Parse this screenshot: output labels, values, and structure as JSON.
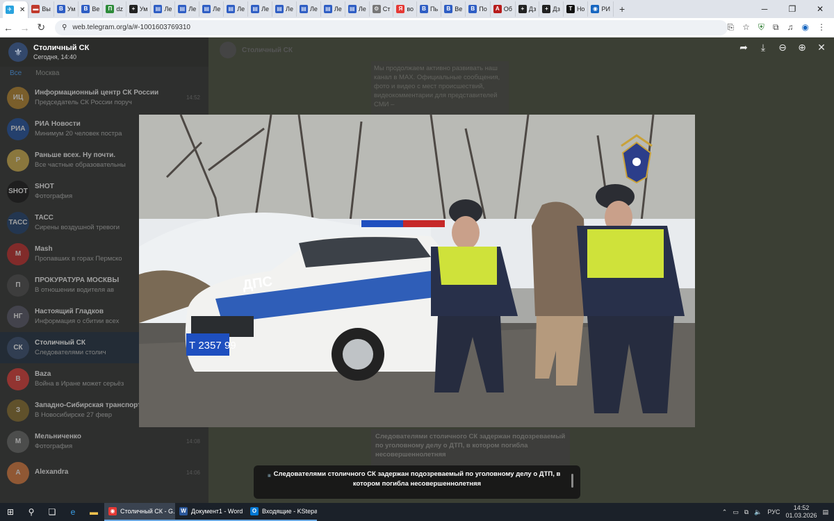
{
  "browser": {
    "tabs": [
      {
        "label": "",
        "active": true,
        "color": "#2aa3de",
        "glyph": "✈"
      },
      {
        "label": "Вы",
        "color": "#c0392b",
        "glyph": "▬"
      },
      {
        "label": "Ум",
        "color": "#2f5ec4",
        "glyph": "В"
      },
      {
        "label": "Ве",
        "color": "#2f5ec4",
        "glyph": "В"
      },
      {
        "label": "dz",
        "color": "#2e8b3a",
        "glyph": "П"
      },
      {
        "label": "Ум",
        "color": "#222",
        "glyph": "+"
      },
      {
        "label": "Ле",
        "color": "#2f5ec4",
        "glyph": "▤"
      },
      {
        "label": "Ле",
        "color": "#2f5ec4",
        "glyph": "▤"
      },
      {
        "label": "Ле",
        "color": "#2f5ec4",
        "glyph": "▤"
      },
      {
        "label": "Ле",
        "color": "#2f5ec4",
        "glyph": "▤"
      },
      {
        "label": "Ле",
        "color": "#2f5ec4",
        "glyph": "▤"
      },
      {
        "label": "Ле",
        "color": "#2f5ec4",
        "glyph": "▤"
      },
      {
        "label": "Ле",
        "color": "#2f5ec4",
        "glyph": "▤"
      },
      {
        "label": "Ле",
        "color": "#2f5ec4",
        "glyph": "▤"
      },
      {
        "label": "Ле",
        "color": "#2f5ec4",
        "glyph": "▤"
      },
      {
        "label": "Ст",
        "color": "#777",
        "glyph": "⚙"
      },
      {
        "label": "во",
        "color": "#e53935",
        "glyph": "Я"
      },
      {
        "label": "Пь",
        "color": "#2f5ec4",
        "glyph": "В"
      },
      {
        "label": "Ве",
        "color": "#2f5ec4",
        "glyph": "В"
      },
      {
        "label": "По",
        "color": "#2f5ec4",
        "glyph": "В"
      },
      {
        "label": "Об",
        "color": "#b71c1c",
        "glyph": "A"
      },
      {
        "label": "Дз",
        "color": "#222",
        "glyph": "+"
      },
      {
        "label": "Дз",
        "color": "#222",
        "glyph": "+"
      },
      {
        "label": "Но",
        "color": "#111",
        "glyph": "T"
      },
      {
        "label": "РИ",
        "color": "#1565c0",
        "glyph": "◉"
      }
    ],
    "url": "web.telegram.org/a/#-1001603769310"
  },
  "sidebar": {
    "channel_title": "Столичный СК",
    "channel_sub": "Сегодня, 14:40",
    "filter_all": "Все",
    "filter_moscow": "Москва",
    "chats": [
      {
        "name": "Информационный центр СК России",
        "preview": "Председатель СК России поруч",
        "time": "14:52",
        "color": "#b8862a",
        "initial": "ИЦ"
      },
      {
        "name": "РИА Новости",
        "preview": "Минимум 20 человек постра",
        "time": "",
        "color": "#1d4fa1",
        "initial": "РИА"
      },
      {
        "name": "Раньше всех. Ну почти.",
        "preview": "Все частные образовательны",
        "time": "",
        "color": "#d6b24a",
        "initial": "Р"
      },
      {
        "name": "SHOT",
        "preview": "Фотография",
        "time": "",
        "color": "#111",
        "initial": "SHOT"
      },
      {
        "name": "ТАСС",
        "preview": "Сирены воздушной тревоги",
        "time": "",
        "color": "#1b3d6d",
        "initial": "ТАСС"
      },
      {
        "name": "Mash",
        "preview": "Пропавших в горах Пермско",
        "time": "",
        "color": "#c62828",
        "initial": "M"
      },
      {
        "name": "ПРОКУРАТУРА МОСКВЫ",
        "preview": "В отношении водителя ав",
        "time": "",
        "color": "#4a4a4a",
        "initial": "П"
      },
      {
        "name": "Настоящий Гладков",
        "preview": "Информация о сбитии всех",
        "time": "",
        "color": "#556",
        "initial": "НГ"
      },
      {
        "name": "Столичный СК",
        "preview": "Следователями столич",
        "time": "",
        "color": "#33486b",
        "initial": "СК",
        "selected": true
      },
      {
        "name": "Baza",
        "preview": "Война в Иране может серьёз",
        "time": "",
        "color": "#e53935",
        "initial": "B"
      },
      {
        "name": "Западно-Сибирская транспорт",
        "preview": "В Новосибирске 27 февр",
        "time": "",
        "color": "#8a6d2a",
        "initial": "З"
      },
      {
        "name": "Мельниченко",
        "preview": "Фотография",
        "time": "14:08",
        "color": "#666",
        "initial": "М"
      },
      {
        "name": "Alexandra",
        "preview": "",
        "time": "14:06",
        "color": "#e07a3a",
        "initial": "A"
      }
    ]
  },
  "main": {
    "header_title": "Столичный СК",
    "top_message": "Мы продолжаем активно развивать наш канал в МАХ. Официальные сообщения, фото и видео с мест происшествий, видеокомментарии для представителей СМИ –",
    "bottom_message": "Следователями столичного СК задержан подозреваемый по уголовному делу о ДТП, в котором погибла несовершеннолетняя"
  },
  "video": {
    "plate_text": "Т 2357 99",
    "car_text": "ДПС"
  },
  "caption": {
    "text": "Следователями столичного СК задержан подозреваемый по уголовному делу о ДТП, в котором погибла несовершеннолетняя"
  },
  "taskbar": {
    "apps": [
      {
        "label": "Столичный СК - G...",
        "active": true,
        "color": "#e53935",
        "glyph": "◉"
      },
      {
        "label": "Документ1 - Word",
        "active": false,
        "color": "#2b579a",
        "glyph": "W"
      },
      {
        "label": "Входящие - KStepa...",
        "active": false,
        "color": "#0078d4",
        "glyph": "O"
      }
    ],
    "lang": "РУС",
    "time": "14:52",
    "date": "01.03.2026"
  }
}
